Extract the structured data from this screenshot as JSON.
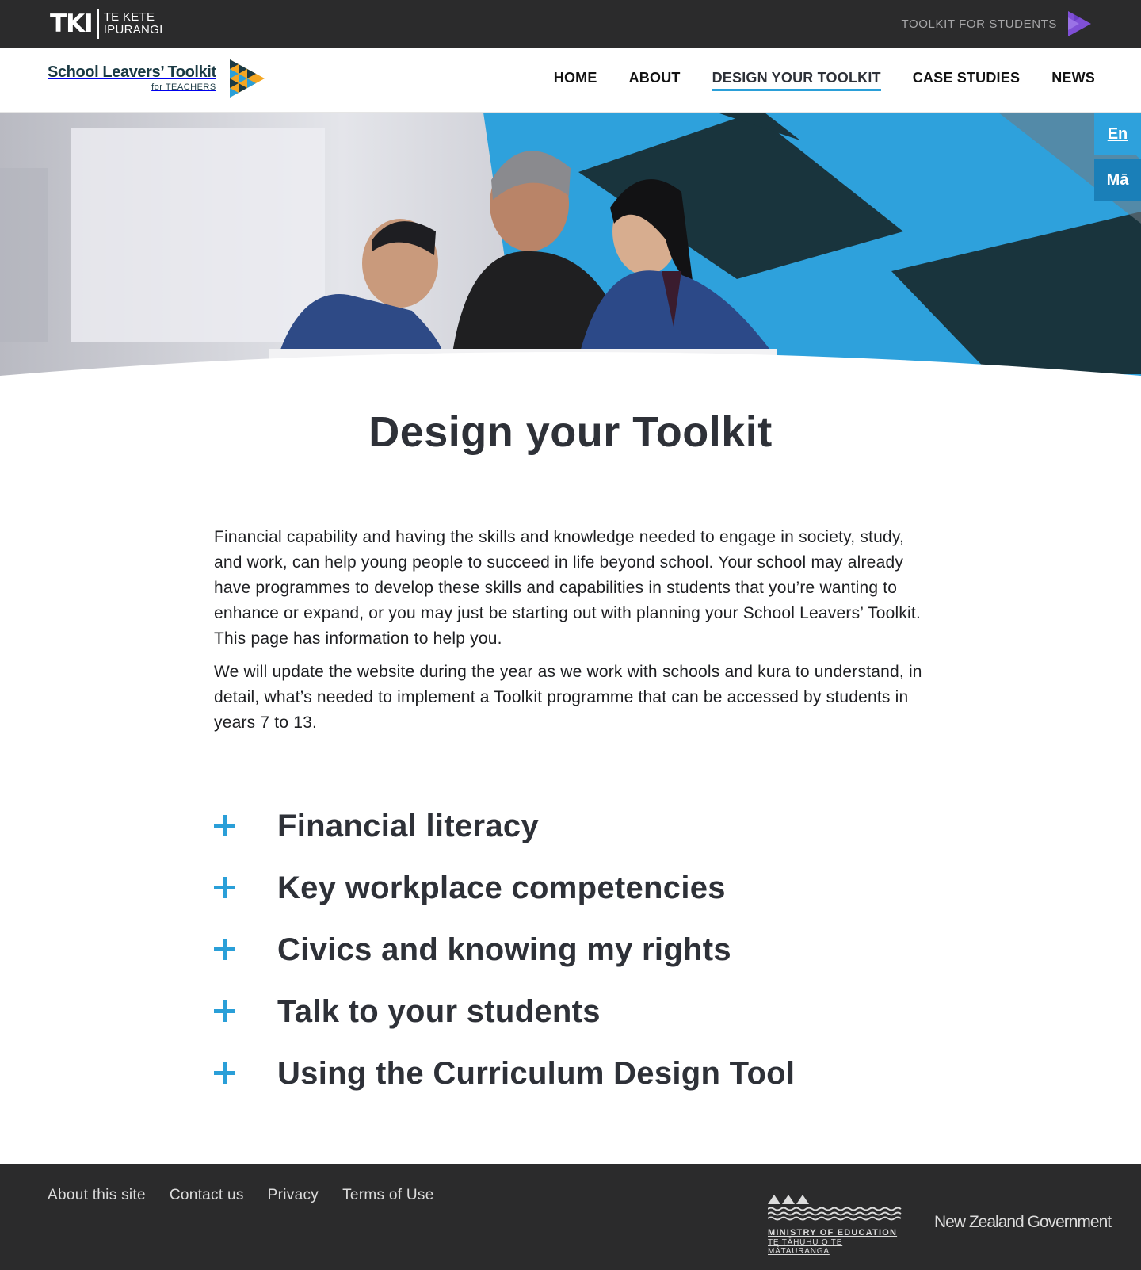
{
  "topbar": {
    "tki_mark": "TKI",
    "tki_line1": "TE KETE",
    "tki_line2": "IPURANGI",
    "students_link": "TOOLKIT FOR STUDENTS",
    "play_color": "#7f4fd6"
  },
  "header": {
    "brand_title": "School Leavers’ Toolkit",
    "brand_sub": "for TEACHERS",
    "nav": [
      {
        "label": "HOME",
        "active": false
      },
      {
        "label": "ABOUT",
        "active": false
      },
      {
        "label": "DESIGN YOUR TOOLKIT",
        "active": true
      },
      {
        "label": "CASE STUDIES",
        "active": false
      },
      {
        "label": "NEWS",
        "active": false
      }
    ]
  },
  "language": {
    "english": "En",
    "maori": "Mā"
  },
  "main": {
    "title": "Design your Toolkit",
    "intro": [
      "Financial capability and having the skills and knowledge needed to engage in society, study, and work, can help young people to succeed in life beyond school. Your school may already have programmes to develop these skills and capabilities in students that you’re wanting to enhance or expand, or you may just be starting out with planning your School Leavers’ Toolkit. This page has information to help you.",
      "We will update the website during the year as we work with schools and kura to understand, in detail, what’s needed to implement a Toolkit programme that can be accessed by students in years 7 to 13."
    ],
    "accordion": [
      "Financial literacy",
      "Key workplace competencies",
      "Civics and knowing my rights",
      "Talk to your students",
      "Using the Curriculum Design Tool"
    ]
  },
  "footer": {
    "links": [
      "About this site",
      "Contact us",
      "Privacy",
      "Terms of Use"
    ],
    "moe_line1": "MINISTRY OF EDUCATION",
    "moe_line2": "TE TĀHUHU O TE MĀTAURANGA",
    "nz_government": "New Zealand Government"
  },
  "colors": {
    "accent_blue": "#2a9fd8",
    "dark_teal": "#19343d",
    "footer_bg": "#2b2b2c"
  }
}
